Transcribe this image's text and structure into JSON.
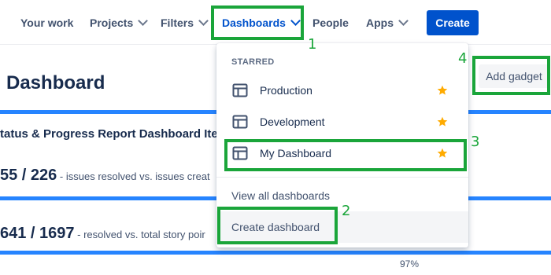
{
  "nav": {
    "items": [
      {
        "label": "Your work",
        "has_chevron": false
      },
      {
        "label": "Projects",
        "has_chevron": true
      },
      {
        "label": "Filters",
        "has_chevron": true
      },
      {
        "label": "Dashboards",
        "has_chevron": true,
        "active": true
      },
      {
        "label": "People",
        "has_chevron": false
      },
      {
        "label": "Apps",
        "has_chevron": true
      }
    ],
    "create_label": "Create"
  },
  "page": {
    "title": "Dashboard",
    "add_gadget_label": "Add gadget",
    "gadget_title": "tatus & Progress Report Dashboard Ite",
    "stats": [
      {
        "number": "55 / 226",
        "text": "- issues resolved vs. issues creat"
      },
      {
        "number": "641 / 1697",
        "text": "- resolved vs. total story poir"
      }
    ],
    "percent": "97%"
  },
  "dropdown": {
    "heading": "STARRED",
    "starred": [
      {
        "label": "Production",
        "icon": "dashboard-icon",
        "starred": true
      },
      {
        "label": "Development",
        "icon": "dashboard-icon",
        "starred": true
      },
      {
        "label": "My Dashboard",
        "icon": "dashboard-icon",
        "starred": true
      }
    ],
    "view_all_label": "View all dashboards",
    "create_label": "Create dashboard"
  },
  "annotations": [
    "1",
    "2",
    "3",
    "4"
  ],
  "colors": {
    "primary": "#0052cc",
    "annotation": "#1aa53a",
    "star": "#ffab00",
    "bar": "#2684ff"
  }
}
